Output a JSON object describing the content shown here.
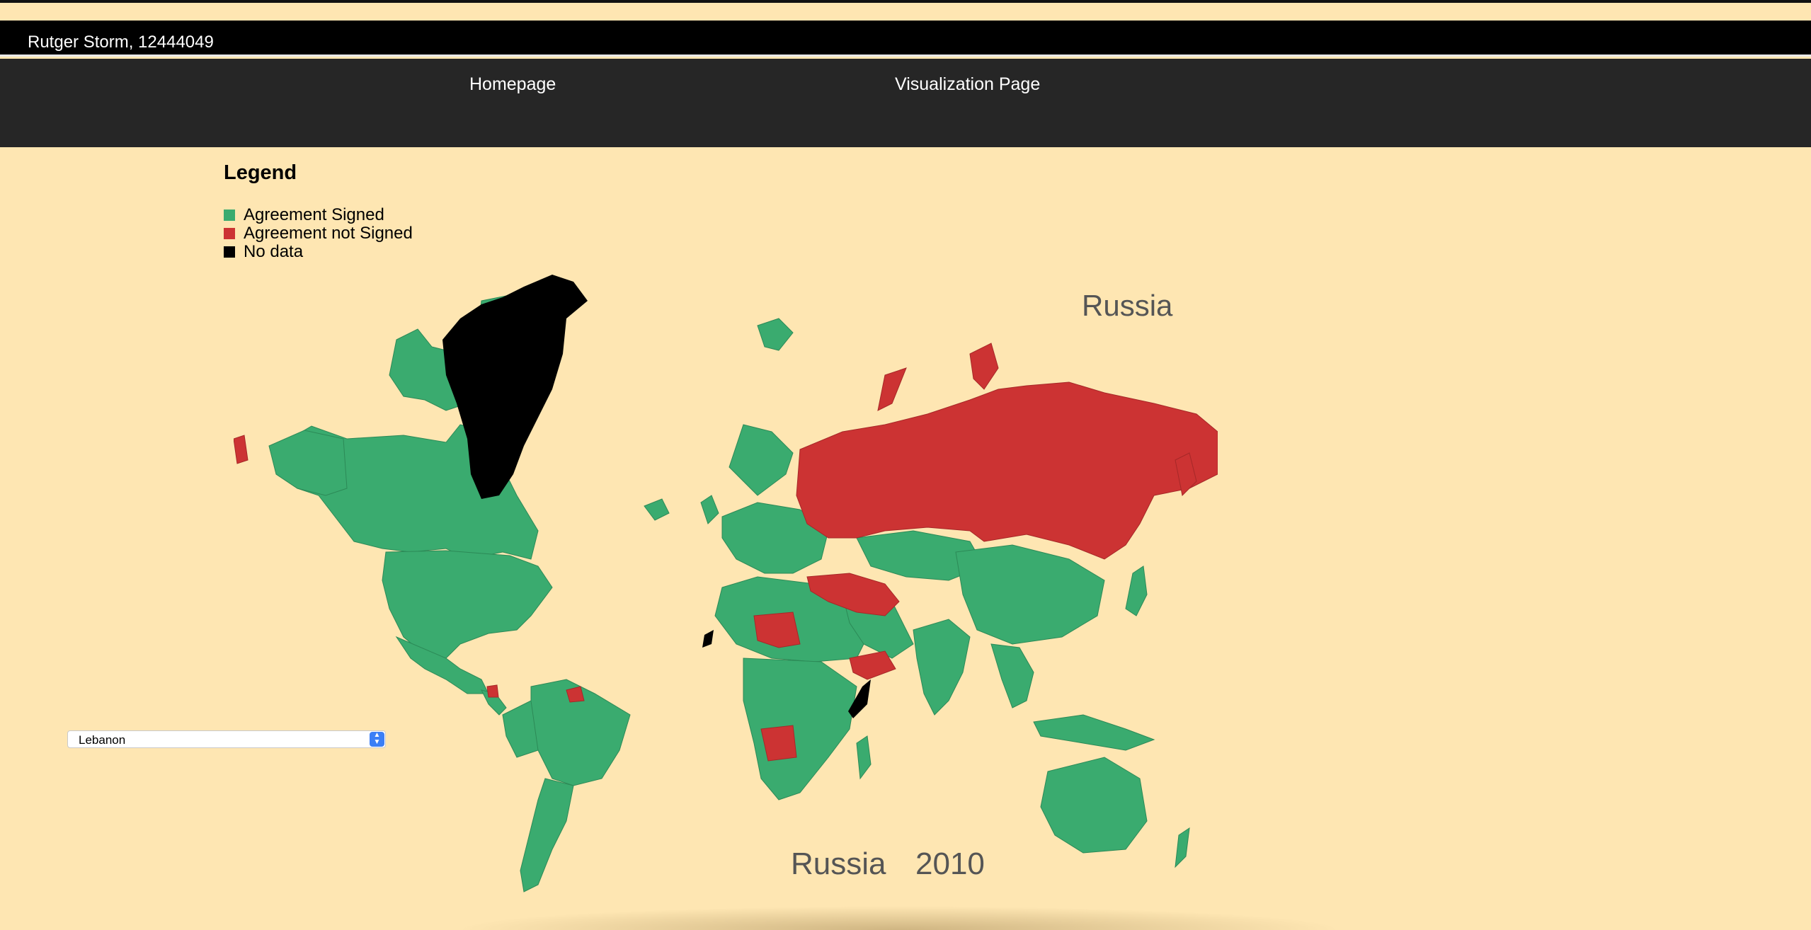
{
  "header": {
    "student_info": "Rutger Storm, 12444049"
  },
  "nav": {
    "home_label": "Homepage",
    "vis_label": "Visualization Page"
  },
  "legend": {
    "title": "Legend",
    "items": [
      {
        "label": "Agreement Signed",
        "color": "#3aab6f"
      },
      {
        "label": "Agreement not Signed",
        "color": "#cc3333"
      },
      {
        "label": "No data",
        "color": "#000000"
      }
    ]
  },
  "map": {
    "hover_country": "Russia",
    "selected_country": "Russia",
    "selected_year": "2010",
    "colors": {
      "signed": "#3aab6f",
      "not_signed": "#cc3333",
      "no_data": "#000000",
      "background": "#fee6b2"
    }
  },
  "country_select": {
    "value": "Lebanon",
    "icon": "chevron-updown-icon"
  }
}
